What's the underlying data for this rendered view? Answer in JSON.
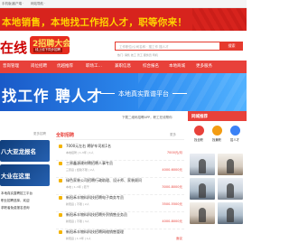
{
  "topbar": {
    "left": "手机版|客户端 ·",
    "middle": "网站导航 ·"
  },
  "banner": {
    "slogan": "本地销售，本地找工作招人才，职等你来！"
  },
  "header": {
    "logo": "在线",
    "badge_main": "2招聘大会",
    "badge_sub": "线上线下同步招聘",
    "search_placeholder": "工作职位/公司名称 · 搜工作 搜人才",
    "search_button": "搜索",
    "hotwords": "热门: 销售 技工 普工 服务员 司机"
  },
  "nav": [
    {
      "label": "普岗管理"
    },
    {
      "label": "岗位招聘"
    },
    {
      "label": "优越推荐"
    },
    {
      "label": "职场工…"
    },
    {
      "label": "兼职信息"
    },
    {
      "label": "综合报名"
    },
    {
      "label": "本地商城"
    },
    {
      "label": "更多服务"
    }
  ],
  "hero": {
    "title": "找工作 聘人才",
    "subtitle": "本地真实靠谱平台"
  },
  "feedback_link": "下载二维码招聘APP，职工在线帮你",
  "left": {
    "more": "更多招聘",
    "promo1": "八大亚龙报名",
    "promo2": "大业在这里",
    "text1": "本地真实直聘招工平台",
    "text2": "职业招聘选择，欢迎",
    "text3": "求职者免费报名咨询"
  },
  "section": {
    "title": "全职招聘",
    "more": "更多"
  },
  "jobs": [
    {
      "title": "7000元左右 聘驴车司机1名",
      "meta": "本地招聘 | 1-3年 | 1人",
      "salary": "7000元/月"
    },
    {
      "title": "三原鑫源建材聘招聘人事专员",
      "meta": "三原县 | 经验不限 | 2人",
      "salary": "4000-6000元"
    },
    {
      "title": "绿色家装公司招聘行政助理、设计师、家装顾问",
      "meta": "本地 | 1-3年 | 若干",
      "salary": "3000-8000元"
    },
    {
      "title": "新阳禾丰物料科技招聘电子商务专员",
      "meta": "新阳县 | 不限 | 2人",
      "salary": "3500-5500元"
    },
    {
      "title": "新阳禾丰物料科技招聘外贸销售业务员",
      "meta": "新阳县 | 不限 | 3人",
      "salary": "4000-8000元"
    },
    {
      "title": "新阳禾丰物料科技招聘网络销售管理",
      "meta": "新阳县 | 1-3年 | 1人",
      "salary": "面议"
    }
  ],
  "right": {
    "head": "同城推荐",
    "quick": [
      {
        "label": "找全职",
        "color": "#e8413a"
      },
      {
        "label": "找兼职",
        "color": "#f39c12"
      },
      {
        "label": "招人才",
        "color": "#3b82f6"
      }
    ]
  }
}
